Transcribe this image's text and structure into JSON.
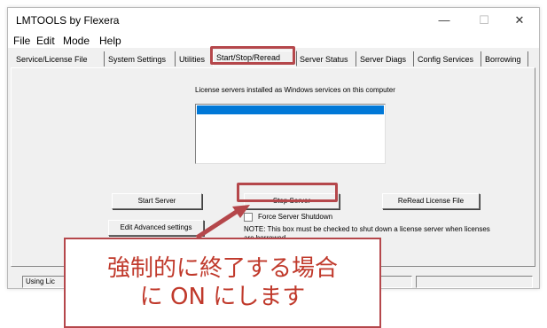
{
  "window": {
    "title": "LMTOOLS by Flexera",
    "minimize_glyph": "—",
    "maximize_glyph": "☐",
    "close_glyph": "✕"
  },
  "menu": [
    "File",
    "Edit",
    "Mode",
    "Help"
  ],
  "tabs": [
    {
      "label": "Service/License File"
    },
    {
      "label": "System Settings"
    },
    {
      "label": "Utilities"
    },
    {
      "label": "Start/Stop/Reread",
      "active": true
    },
    {
      "label": "Server Status"
    },
    {
      "label": "Server Diags"
    },
    {
      "label": "Config Services"
    },
    {
      "label": "Borrowing"
    }
  ],
  "panel": {
    "services_label": "License servers installed as Windows services on this computer",
    "selected_service": "",
    "start_button": "Start Server",
    "stop_button": "Stop Server",
    "reread_button": "ReRead License File",
    "advanced_button": "Edit Advanced settings",
    "force_shutdown_label": "Force Server Shutdown",
    "force_shutdown_checked": false,
    "note": "NOTE:  This box must be checked to shut down a license server when licenses are borrowed."
  },
  "status_bar": {
    "text": "Using Lic"
  },
  "annotation": {
    "line1": "強制的に終了する場合",
    "line2": "に ON にします",
    "color": "#b5474b"
  }
}
